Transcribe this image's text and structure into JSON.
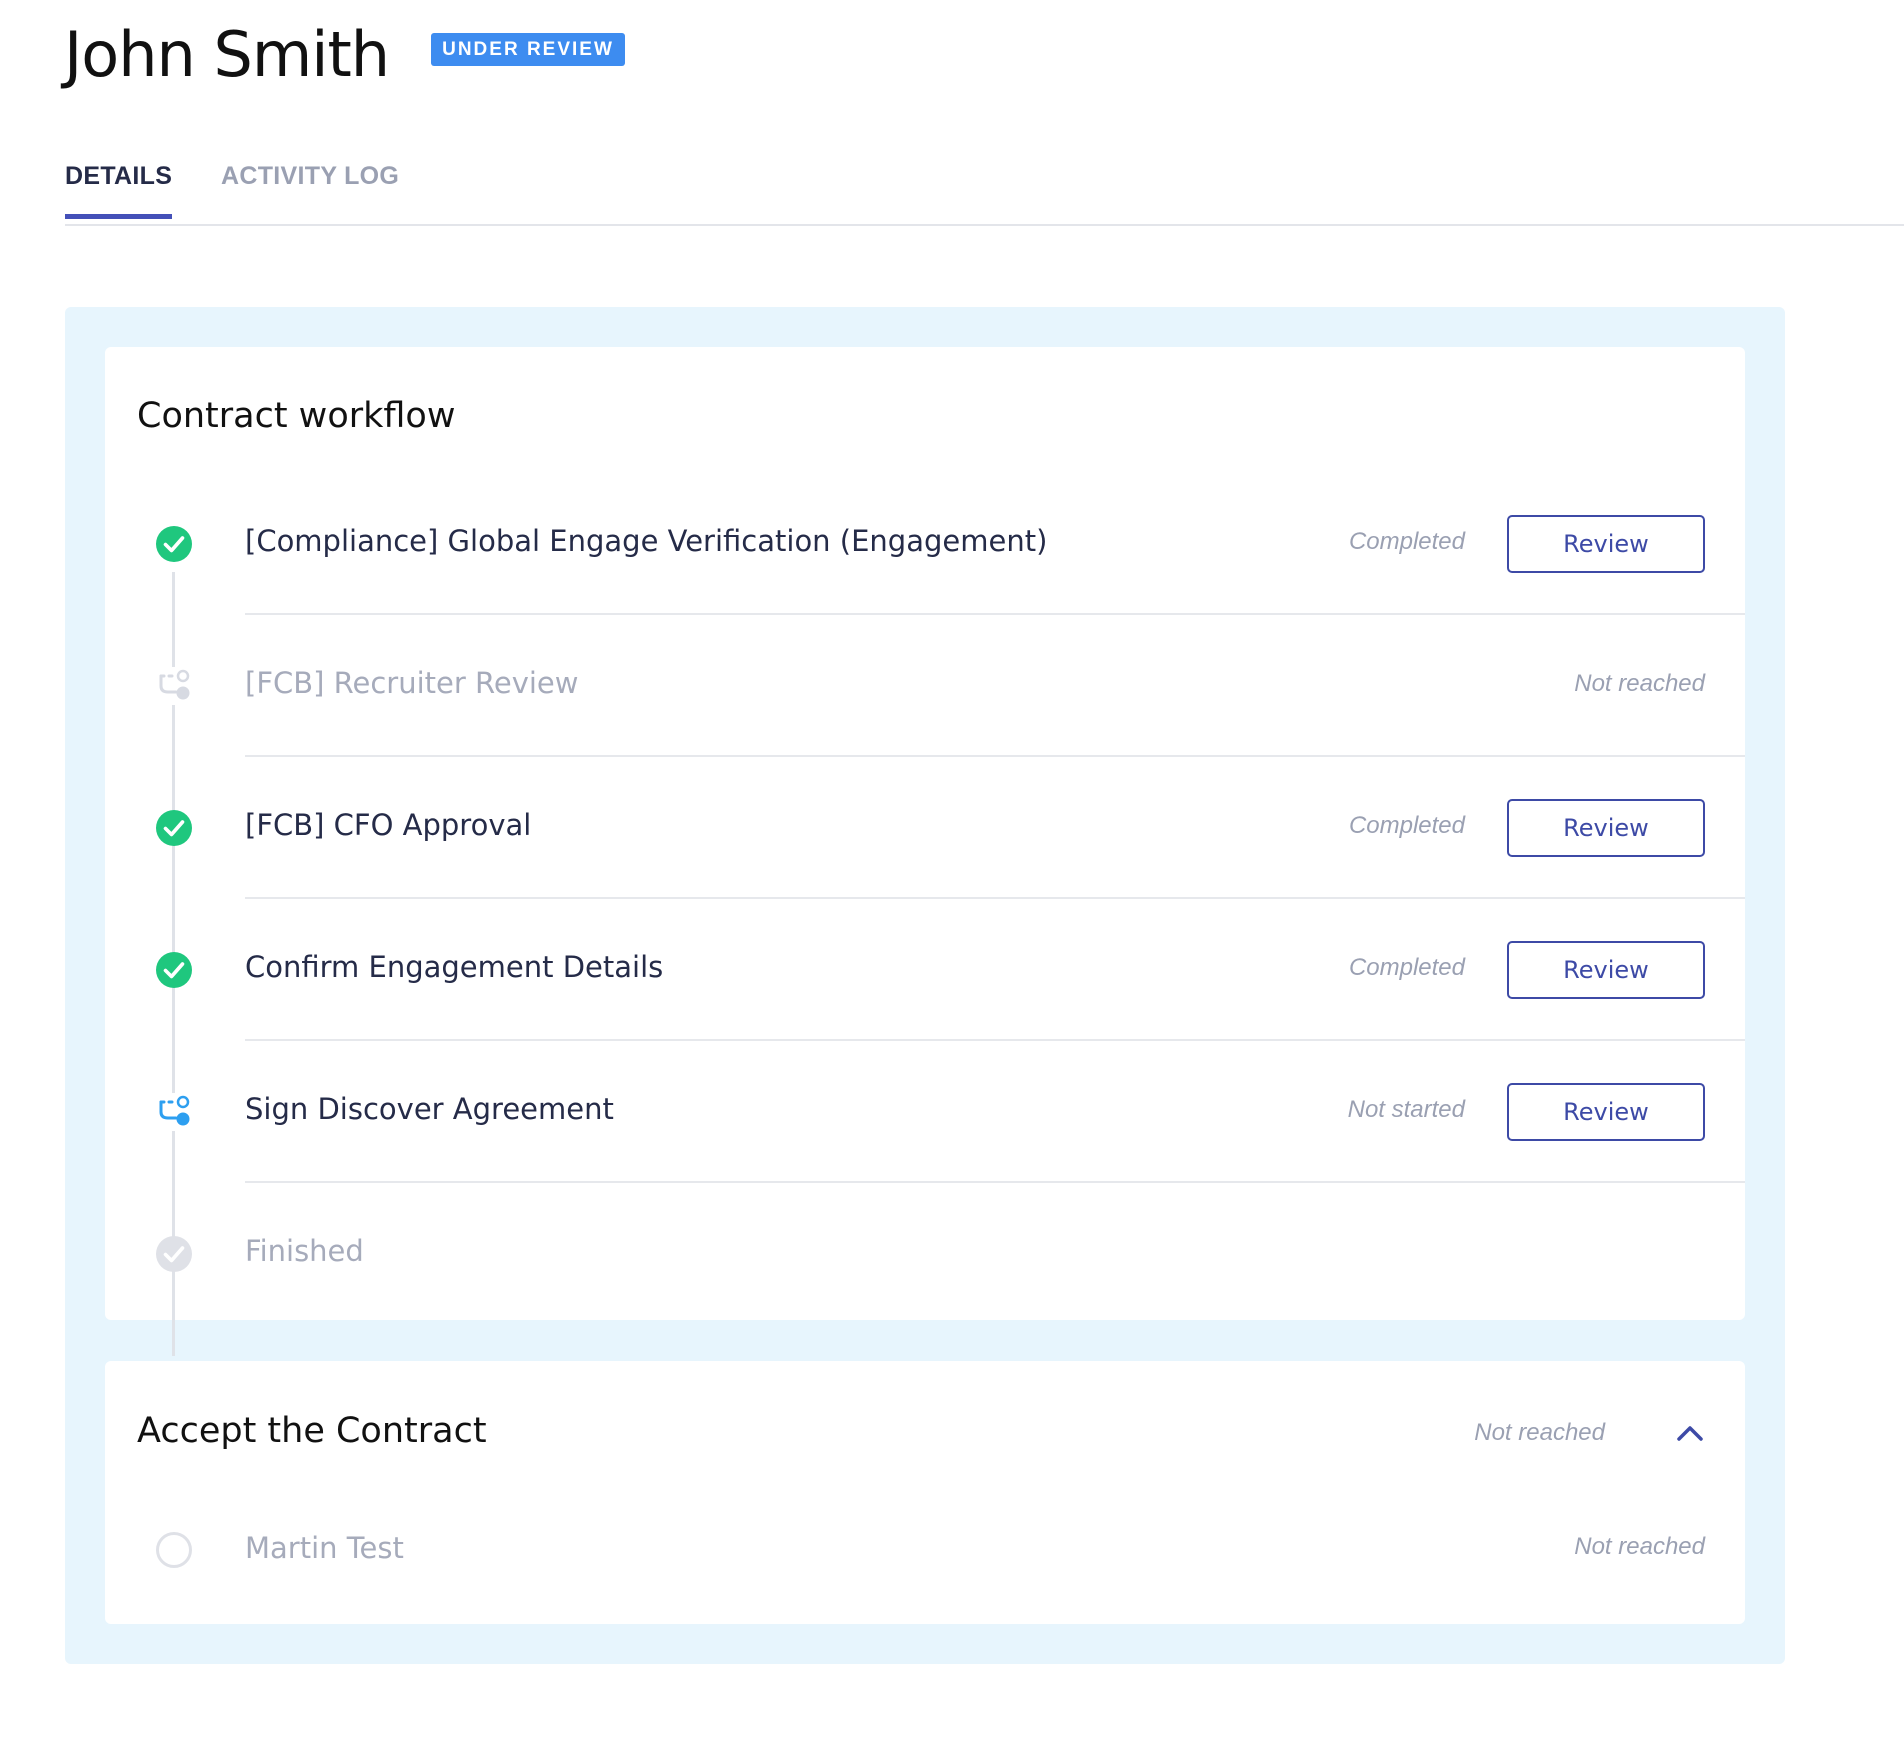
{
  "header": {
    "name": "John Smith",
    "badge": "UNDER REVIEW"
  },
  "tabs": [
    {
      "label": "DETAILS",
      "active": true
    },
    {
      "label": "ACTIVITY LOG",
      "active": false
    }
  ],
  "workflow": {
    "title": "Contract workflow",
    "steps": [
      {
        "label": "[Compliance] Global Engage Verification (Engagement)",
        "status": "Completed",
        "button": "Review",
        "icon": "check-circle-icon"
      },
      {
        "label": "[FCB] Recruiter Review",
        "status": "Not reached",
        "icon": "branch-icon"
      },
      {
        "label": "[FCB] CFO Approval",
        "status": "Completed",
        "button": "Review",
        "icon": "check-circle-icon"
      },
      {
        "label": "Confirm Engagement Details",
        "status": "Completed",
        "button": "Review",
        "icon": "check-circle-icon"
      },
      {
        "label": "Sign Discover Agreement",
        "status": "Not started",
        "button": "Review",
        "icon": "branch-icon"
      },
      {
        "label": "Finished",
        "icon": "check-circle-icon"
      }
    ]
  },
  "contract": {
    "title": "Accept the Contract",
    "status": "Not reached",
    "items": [
      {
        "label": "Martin Test",
        "status": "Not reached",
        "icon": "empty-circle-icon"
      }
    ]
  },
  "colors": {
    "badge": "#3d8cf0",
    "accent": "#3d4aa6",
    "success": "#1fc77e",
    "active_step": "#2d9ff0",
    "muted": "#d7dae2",
    "panel_bg": "#e7f5fd"
  }
}
